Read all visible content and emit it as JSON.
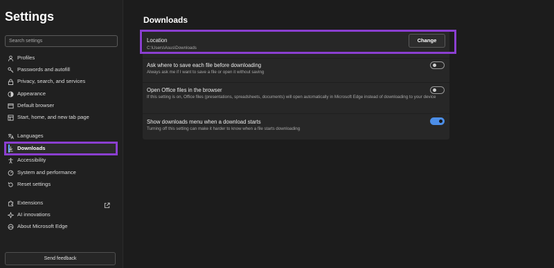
{
  "app": {
    "title": "Settings"
  },
  "search": {
    "placeholder": "Search settings"
  },
  "sidebar": {
    "items": [
      {
        "label": "Profiles",
        "icon": "profile-icon"
      },
      {
        "label": "Passwords and autofill",
        "icon": "key-icon"
      },
      {
        "label": "Privacy, search, and services",
        "icon": "lock-icon"
      },
      {
        "label": "Appearance",
        "icon": "appearance-icon"
      },
      {
        "label": "Default browser",
        "icon": "browser-icon"
      },
      {
        "label": "Start, home, and new tab page",
        "icon": "home-icon"
      },
      {
        "label": "Languages",
        "icon": "languages-icon"
      },
      {
        "label": "Downloads",
        "icon": "download-icon",
        "active": true
      },
      {
        "label": "Accessibility",
        "icon": "accessibility-icon"
      },
      {
        "label": "System and performance",
        "icon": "system-icon"
      },
      {
        "label": "Reset settings",
        "icon": "reset-icon"
      },
      {
        "label": "Extensions",
        "icon": "extensions-icon"
      },
      {
        "label": "AI innovations",
        "icon": "ai-icon"
      },
      {
        "label": "About Microsoft Edge",
        "icon": "edge-icon"
      }
    ],
    "feedback_label": "Send feedback"
  },
  "main": {
    "title": "Downloads",
    "location": {
      "label": "Location",
      "path": "C:\\Users\\Asus\\Downloads",
      "button": "Change"
    },
    "settings": [
      {
        "title": "Ask where to save each file before downloading",
        "description": "Always ask me if I want to save a file or open it without saving",
        "enabled": false
      },
      {
        "title": "Open Office files in the browser",
        "description": "If this setting is on, Office files (presentations, spreadsheets, documents) will open automatically in Microsoft Edge instead of downloading to your device",
        "enabled": false
      },
      {
        "title": "Show downloads menu when a download starts",
        "description": "Turning off this setting can make it harder to know when a file starts downloading",
        "enabled": true
      }
    ]
  },
  "colors": {
    "highlight": "#8b3fd1",
    "toggle_on": "#4c8ee8",
    "active_indicator": "#60b0ff"
  }
}
